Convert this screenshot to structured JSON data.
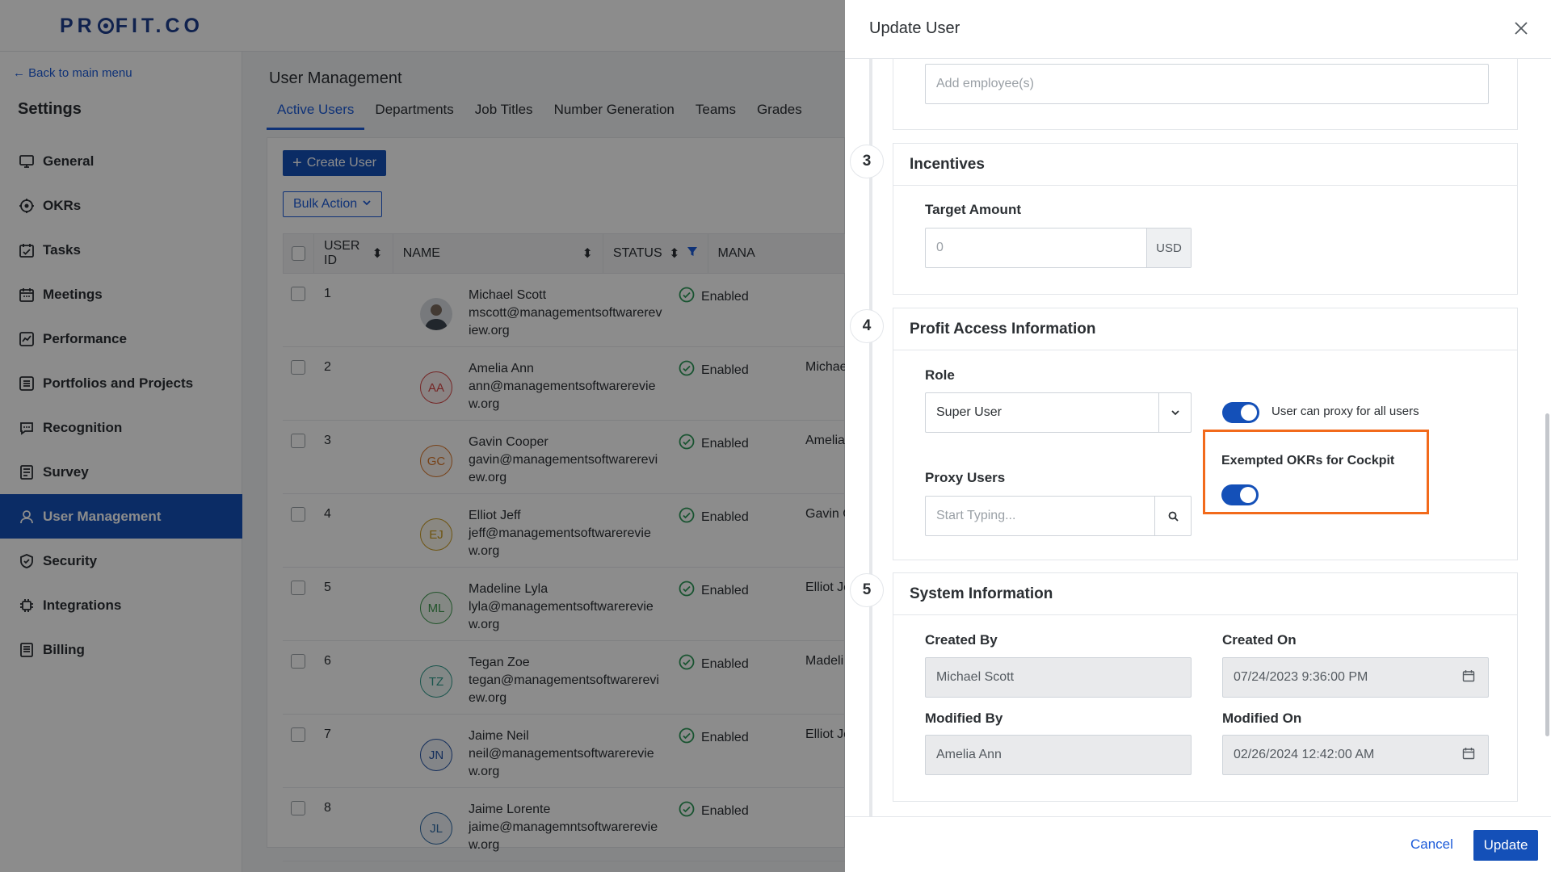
{
  "app": {
    "logo": "PROFIT.CO",
    "logo_prefix": "PR",
    "logo_suffix": "FIT.CO"
  },
  "sidebar": {
    "back_label": "Back to main menu",
    "title": "Settings",
    "items": [
      {
        "label": "General",
        "icon": "monitor-icon"
      },
      {
        "label": "OKRs",
        "icon": "target-icon"
      },
      {
        "label": "Tasks",
        "icon": "task-calendar-icon"
      },
      {
        "label": "Meetings",
        "icon": "calendar-icon"
      },
      {
        "label": "Performance",
        "icon": "chart-icon"
      },
      {
        "label": "Portfolios and Projects",
        "icon": "list-icon"
      },
      {
        "label": "Recognition",
        "icon": "chat-icon"
      },
      {
        "label": "Survey",
        "icon": "survey-icon"
      },
      {
        "label": "User Management",
        "icon": "user-icon"
      },
      {
        "label": "Security",
        "icon": "shield-icon"
      },
      {
        "label": "Integrations",
        "icon": "chip-icon"
      },
      {
        "label": "Billing",
        "icon": "document-icon"
      }
    ]
  },
  "main": {
    "title": "User Management",
    "tabs": [
      "Active Users",
      "Departments",
      "Job Titles",
      "Number Generation",
      "Teams",
      "Grades"
    ],
    "create_label": "Create User",
    "bulk_label": "Bulk Action",
    "columns": [
      "USER ID",
      "NAME",
      "STATUS",
      "MANA"
    ],
    "rows": [
      {
        "id": "1",
        "name": "Michael Scott",
        "email": "mscott@managementsoftwarereview.org",
        "status": "Enabled",
        "manager": "",
        "initials": "",
        "color": "#6b7280"
      },
      {
        "id": "2",
        "name": "Amelia Ann",
        "email": "ann@managementsoftwarereview.org",
        "status": "Enabled",
        "manager": "Michae",
        "initials": "AA",
        "color": "#d64545"
      },
      {
        "id": "3",
        "name": "Gavin Cooper",
        "email": "gavin@managementsoftwarereview.org",
        "status": "Enabled",
        "manager": "Amelia",
        "initials": "GC",
        "color": "#d9772b"
      },
      {
        "id": "4",
        "name": "Elliot Jeff",
        "email": "jeff@managementsoftwarereview.org",
        "status": "Enabled",
        "manager": "Gavin C",
        "initials": "EJ",
        "color": "#c89a1e"
      },
      {
        "id": "5",
        "name": "Madeline Lyla",
        "email": "lyla@managementsoftwarereview.org",
        "status": "Enabled",
        "manager": "Elliot Je",
        "initials": "ML",
        "color": "#3f9a4f"
      },
      {
        "id": "6",
        "name": "Tegan Zoe",
        "email": "tegan@managementsoftwarereview.org",
        "status": "Enabled",
        "manager": "Madeli",
        "initials": "TZ",
        "color": "#2e9a8a"
      },
      {
        "id": "7",
        "name": "Jaime Neil",
        "email": "neil@managementsoftwarereview.org",
        "status": "Enabled",
        "manager": "Elliot Je",
        "initials": "JN",
        "color": "#2453a6"
      },
      {
        "id": "8",
        "name": "Jaime Lorente",
        "email": "jaime@managemntsoftwarereview.org",
        "status": "Enabled",
        "manager": "",
        "initials": "JL",
        "color": "#2e6aa6"
      }
    ]
  },
  "panel": {
    "title": "Update User",
    "employees_placeholder": "Add employee(s)",
    "incentives": {
      "step": "3",
      "title": "Incentives",
      "target_label": "Target Amount",
      "target_placeholder": "0",
      "currency": "USD"
    },
    "access": {
      "step": "4",
      "title": "Profit Access Information",
      "role_label": "Role",
      "role_value": "Super User",
      "proxy_all_label": "User can proxy for all users",
      "proxy_users_label": "Proxy Users",
      "proxy_placeholder": "Start Typing...",
      "exempted_label": "Exempted OKRs for Cockpit"
    },
    "system": {
      "step": "5",
      "title": "System Information",
      "created_by_label": "Created By",
      "created_by": "Michael Scott",
      "created_on_label": "Created On",
      "created_on": "07/24/2023 9:36:00 PM",
      "modified_by_label": "Modified By",
      "modified_by": "Amelia Ann",
      "modified_on_label": "Modified On",
      "modified_on": "02/26/2024 12:42:00 AM"
    },
    "cancel_label": "Cancel",
    "update_label": "Update"
  },
  "colors": {
    "accent": "#1450b8",
    "link": "#1c5bd9",
    "highlight": "#f26a1b",
    "success": "#2e9a5a"
  }
}
